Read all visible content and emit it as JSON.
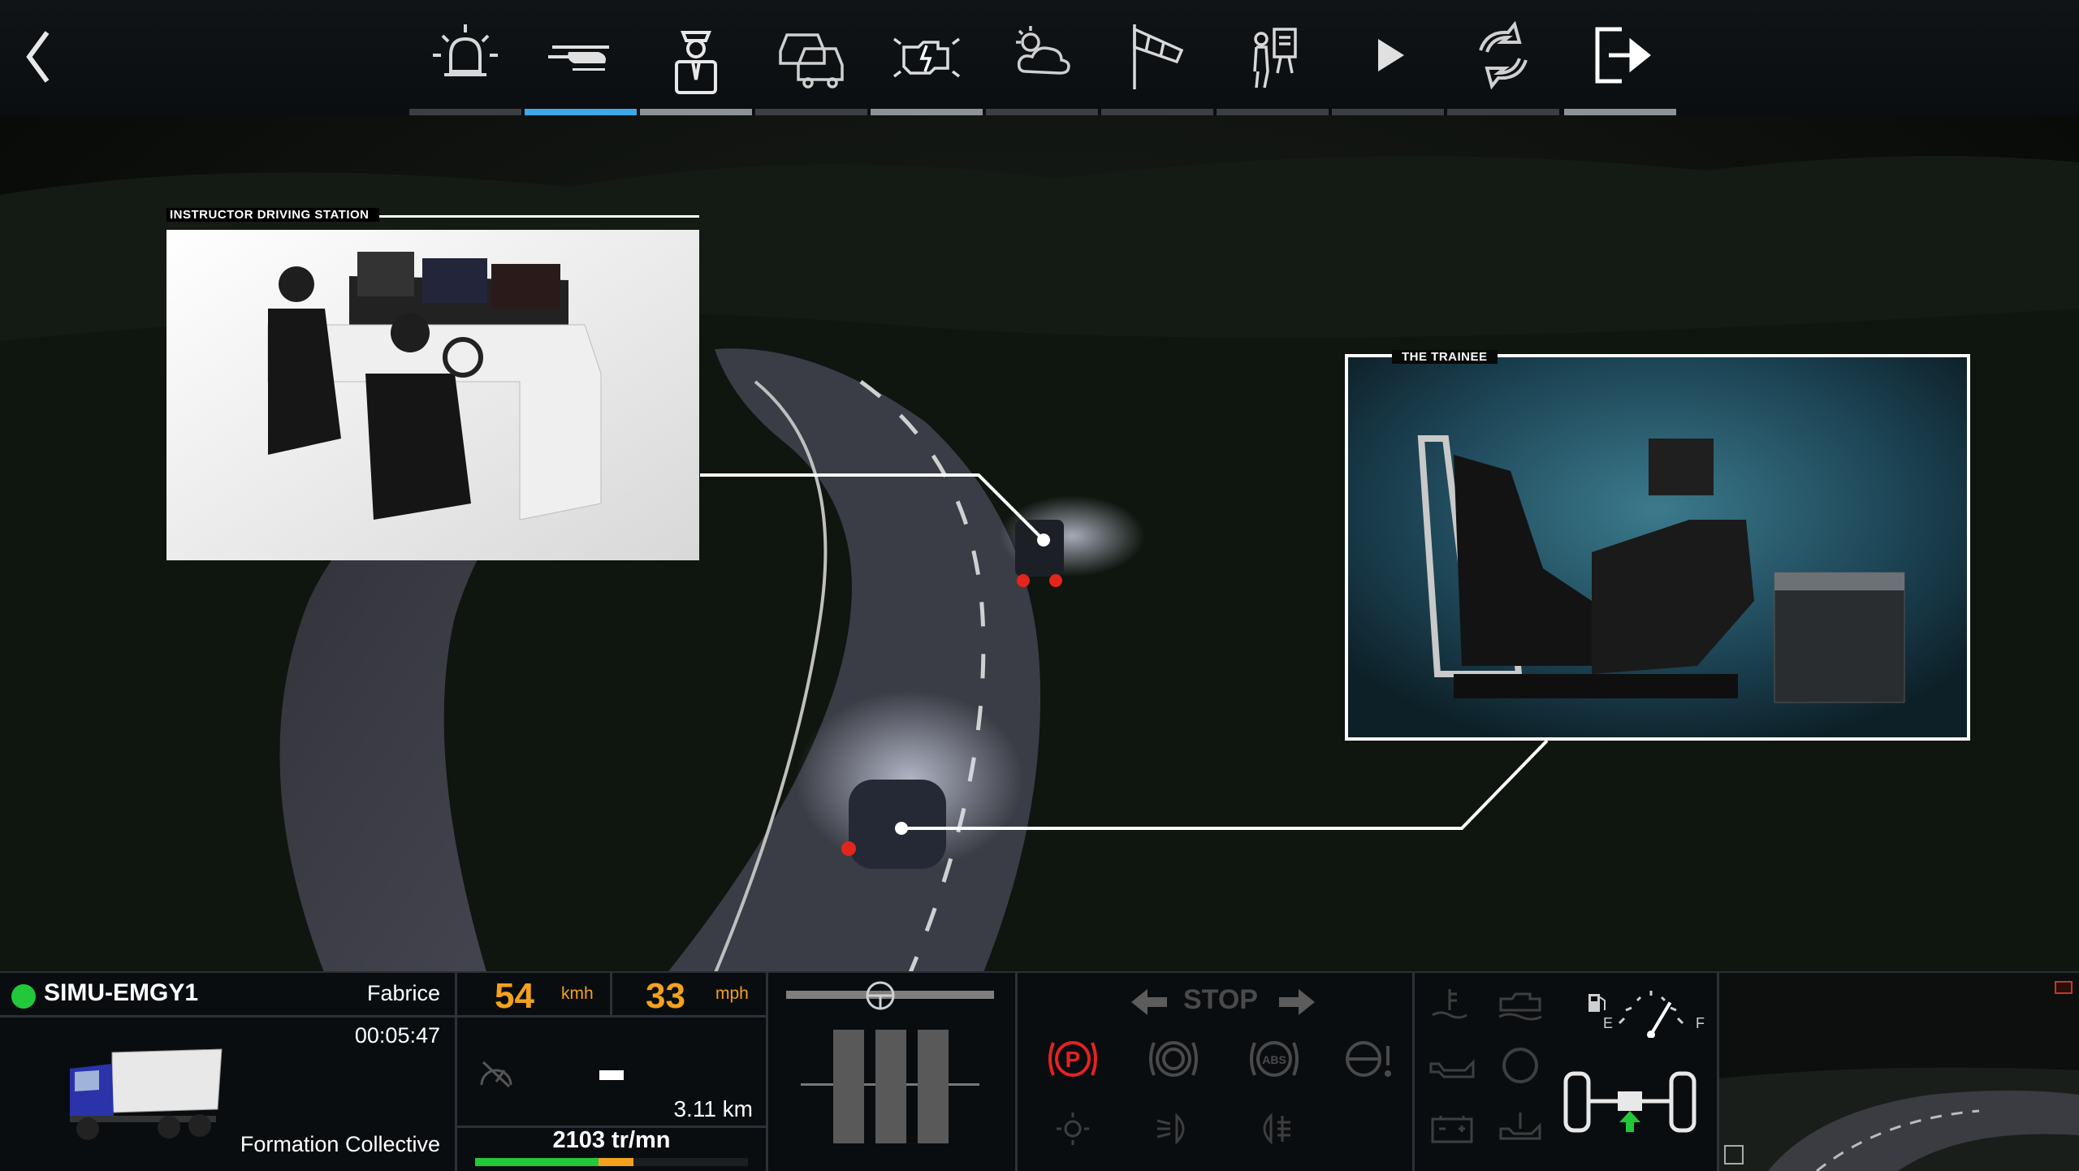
{
  "toolbar": {
    "tools": [
      {
        "icon": "siren-icon"
      },
      {
        "icon": "helicopter-icon",
        "active": true
      },
      {
        "icon": "officer-icon"
      },
      {
        "icon": "traffic-cars-icon"
      },
      {
        "icon": "engine-fault-icon"
      },
      {
        "icon": "weather-icon"
      },
      {
        "icon": "windsock-icon"
      },
      {
        "icon": "instructor-board-icon"
      },
      {
        "icon": "play-icon"
      },
      {
        "icon": "reset-icon"
      },
      {
        "icon": "exit-icon"
      }
    ]
  },
  "panels": {
    "instructor": {
      "title": "INSTRUCTOR DRIVING STATION"
    },
    "trainee": {
      "title": "THE TRAINEE"
    }
  },
  "hud": {
    "vehicle": {
      "status_color": "#22c83a",
      "id": "SIMU-EMGY1",
      "driver": "Fabrice",
      "timer": "00:05:47",
      "mode": "Formation Collective"
    },
    "speed": {
      "kmh_value": "54",
      "kmh_unit": "kmh",
      "mph_value": "33",
      "mph_unit": "mph",
      "distance": "3.11 km",
      "rpm": "2103 tr/mn",
      "rpm_fraction": 0.58
    },
    "signals": {
      "stop_label": "STOP"
    },
    "fuel": {
      "empty_label": "E",
      "full_label": "F",
      "level_fraction": 0.72
    },
    "colors": {
      "accent": "#3fa8e6",
      "speed": "#f2a21d",
      "parking_brake": "#e52222"
    }
  }
}
